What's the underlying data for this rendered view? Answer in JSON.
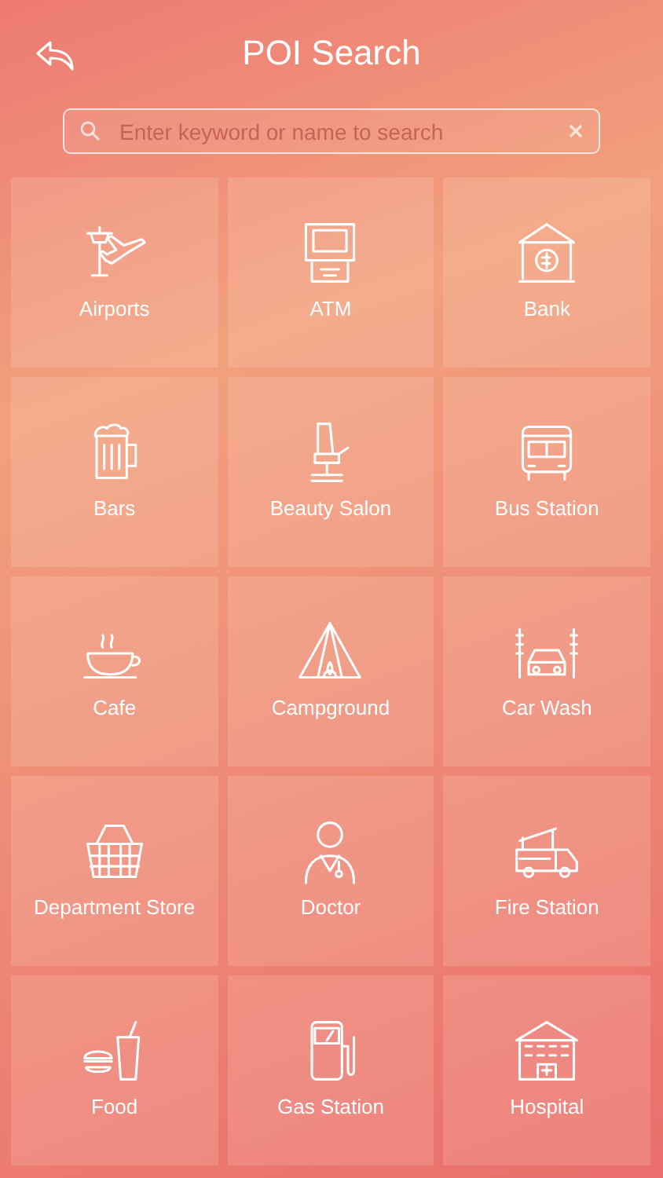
{
  "header": {
    "title": "POI Search"
  },
  "search": {
    "placeholder": "Enter keyword or name to search"
  },
  "categories": [
    {
      "label": "Airports"
    },
    {
      "label": "ATM"
    },
    {
      "label": "Bank"
    },
    {
      "label": "Bars"
    },
    {
      "label": "Beauty Salon"
    },
    {
      "label": "Bus Station"
    },
    {
      "label": "Cafe"
    },
    {
      "label": "Campground"
    },
    {
      "label": "Car Wash"
    },
    {
      "label": "Department Store"
    },
    {
      "label": "Doctor"
    },
    {
      "label": "Fire Station"
    },
    {
      "label": "Food"
    },
    {
      "label": "Gas Station"
    },
    {
      "label": "Hospital"
    }
  ]
}
